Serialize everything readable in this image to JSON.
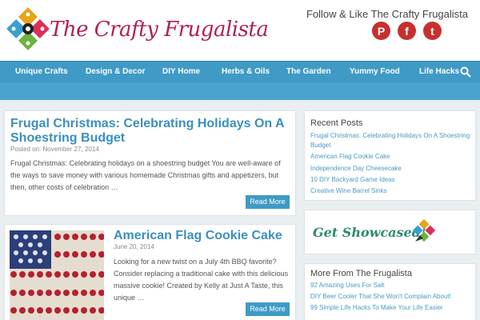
{
  "header": {
    "site_title": "The Crafty Frugalista",
    "follow_text": "Follow & Like The Crafty Frugalista",
    "social": [
      {
        "name": "pinterest",
        "glyph": "P",
        "color": "#c8232c"
      },
      {
        "name": "facebook",
        "glyph": "f",
        "color": "#c8232c"
      },
      {
        "name": "twitter",
        "glyph": "t",
        "color": "#c8232c"
      }
    ]
  },
  "nav": {
    "items": [
      "Unique Crafts",
      "Design & Decor",
      "DIY Home",
      "Herbs & Oils",
      "The Garden",
      "Yummy Food",
      "Life Hacks"
    ]
  },
  "posts": [
    {
      "title": "Frugal Christmas: Celebrating Holidays On A Shoestring Budget",
      "date_prefix": "Posted on:",
      "date": "November 27, 2014",
      "excerpt": "Frugal Christmas: Celebrating holidays on a shoestring budget You are well-aware of the ways to save money with various homemade Christmas gifts and appetizers, but then, other costs of celebration …",
      "button": "Read More"
    },
    {
      "title": "American Flag Cookie Cake",
      "date": "June 20, 2014",
      "excerpt": "Looking for a new twist on a July 4th BBQ favorite? Consider replacing a traditional cake with this delicious massive cookie! Created by Kelly at Just A Taste, this unique …",
      "button": "Read More"
    }
  ],
  "sidebar": {
    "recent_title": "Recent Posts",
    "recent_links": [
      "Frugal Christmas: Celebrating Holidays On A Shoestring Budget",
      "American Flag Cookie Cake",
      "Independence Day Cheesecake",
      "10 DIY Backyard Game Ideas",
      "Creative Wine Barrel Sinks"
    ],
    "showcase_text": "Get Showcased!",
    "more_title": "More From The Frugalista",
    "more_links": [
      "92 Amazing Uses For Salt",
      "DIY Beer Cooler That She Won't Complain About!",
      "99 Simple Life Hacks To Make Your Life Easier"
    ]
  },
  "colors": {
    "nav_blue": "#3f9ac6",
    "title_blue": "#3a8fbf",
    "brand_pink": "#b11f57"
  }
}
